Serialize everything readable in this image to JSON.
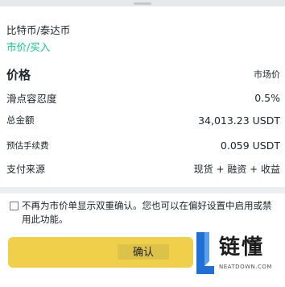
{
  "header": {
    "pair": "比特币/泰达币",
    "order_type": "市价/买入"
  },
  "details": {
    "price": {
      "label": "价格",
      "value": "市场价"
    },
    "slippage": {
      "label": "滑点容忍度",
      "value": "0.5%"
    },
    "total": {
      "label": "总金额",
      "value": "34,013.23 USDT"
    },
    "fee": {
      "label": "预估手续费",
      "value": "0.059 USDT"
    },
    "source": {
      "label": "支付来源",
      "value": "现货 + 融资 + 收益"
    }
  },
  "confirm_preference": {
    "text": "不再为市价单显示双重确认。您也可以在偏好设置中启用或禁用此功能。",
    "checked": false
  },
  "confirm_button": {
    "label": "确认"
  },
  "watermark": {
    "name": "链懂",
    "domain": "NEATDOWN.COM"
  },
  "colors": {
    "accent_green": "#0ecb81",
    "button_yellow": "#f0d04a",
    "logo_blue": "#1f6fd6"
  }
}
